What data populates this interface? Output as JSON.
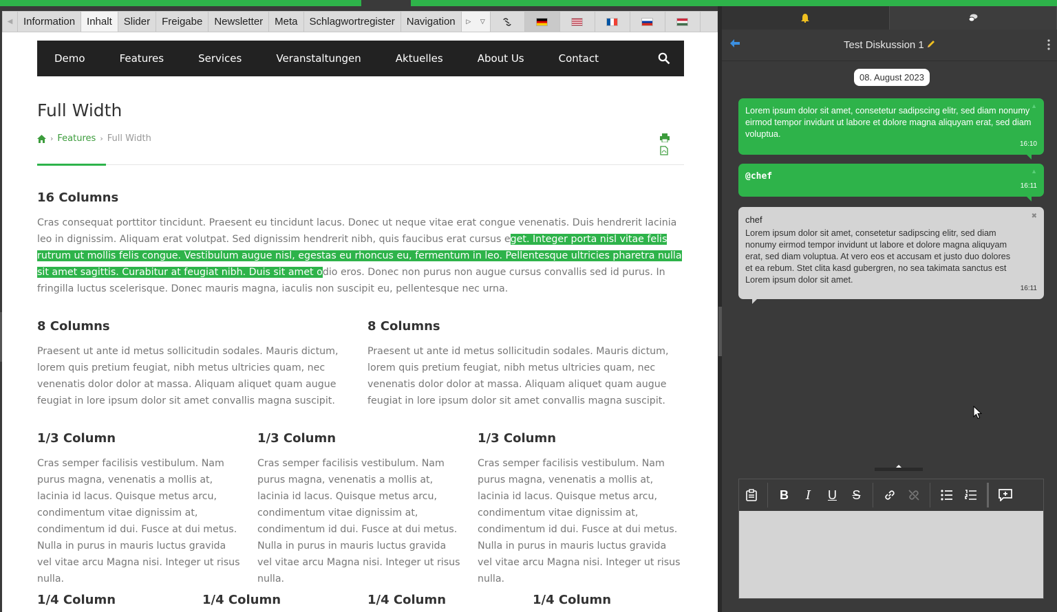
{
  "editor": {
    "tabs": [
      {
        "label": "Information"
      },
      {
        "label": "Inhalt"
      },
      {
        "label": "Slider"
      },
      {
        "label": "Freigabe"
      },
      {
        "label": "Newsletter"
      },
      {
        "label": "Meta"
      },
      {
        "label": "Schlagwortregister"
      },
      {
        "label": "Navigation"
      }
    ],
    "active_tab": "Inhalt",
    "languages": [
      "de",
      "en",
      "fr",
      "ru",
      "hu"
    ],
    "active_language": "de"
  },
  "site": {
    "nav": [
      "Demo",
      "Features",
      "Services",
      "Veranstaltungen",
      "Aktuelles",
      "About Us",
      "Contact"
    ],
    "title": "Full Width",
    "breadcrumb": {
      "link": "Features",
      "current": "Full Width"
    },
    "sections": {
      "s16": {
        "heading": "16 Columns",
        "text_before": "Cras consequat porttitor tincidunt. Praesent eu tincidunt lacus. Donec ut neque vitae erat congue venenatis. Duis hendrerit lacinia leo in dignissim. Aliquam erat volutpat. Sed dignissim hendrerit nibh, quis faucibus erat cursus e",
        "text_selected": "get. Integer porta nisl vitae felis rutrum ut mollis felis congue. Vestibulum augue nisl, egestas eu rhoncus eu, fermentum in leo. Pellentesque ultricies pharetra nulla sit amet sagittis. Curabitur at feugiat nibh. Duis sit amet o",
        "text_after": "dio eros. Donec non purus non augue cursus convallis sed id purus. In fringilla luctus scelerisque. Donec mauris magna, iaculis non suscipit eu, pellentesque nec urna."
      },
      "s8": {
        "heading": "8 Columns",
        "text": "Praesent ut ante id metus sollicitudin sodales. Mauris dictum, lorem quis pretium feugiat, nibh metus ultricies quam, nec venenatis dolor dolor at massa. Aliquam aliquet quam augue feugiat in lore ipsum dolor sit amet convallis magna suscipit."
      },
      "s3": {
        "heading": "1/3 Column",
        "text": "Cras semper facilisis vestibulum. Nam purus magna, venenatis a mollis at, lacinia id lacus. Quisque metus arcu, condimentum vitae dignissim at, condimentum id dui. Fusce at dui metus. Nulla in purus in mauris luctus gravida vel vitae arcu Magna nisi. Integer ut risus nulla."
      },
      "s4": {
        "heading": "1/4 Column"
      }
    }
  },
  "chat": {
    "title": "Test Diskussion 1",
    "date": "08. August 2023",
    "messages": [
      {
        "sender": "",
        "text": "Lorem ipsum dolor sit amet, consetetur sadipscing elitr, sed diam nonumy eirmod tempor invidunt ut labore et dolore magna aliquyam erat, sed diam voluptua.",
        "time": "16:10"
      },
      {
        "sender": "",
        "text": "@chef",
        "time": "16:11"
      },
      {
        "sender": "chef",
        "text": "Lorem ipsum dolor sit amet, consetetur sadipscing elitr, sed diam nonumy eirmod tempor invidunt ut labore et dolore magna aliquyam erat, sed diam voluptua. At vero eos et accusam et justo duo dolores et ea rebum. Stet clita kasd gubergren, no sea takimata sanctus est Lorem ipsum dolor sit amet.",
        "time": "16:11"
      }
    ],
    "toolbar_icons": [
      "paste-icon",
      "bold-icon",
      "italic-icon",
      "underline-icon",
      "strikethrough-icon",
      "link-icon",
      "unlink-icon",
      "bullet-list-icon",
      "numbered-list-icon",
      "add-comment-icon"
    ]
  },
  "colors": {
    "accent": "#2eb34a",
    "dark": "#3a3a3a",
    "bubble_other": "#d4d4d4"
  }
}
